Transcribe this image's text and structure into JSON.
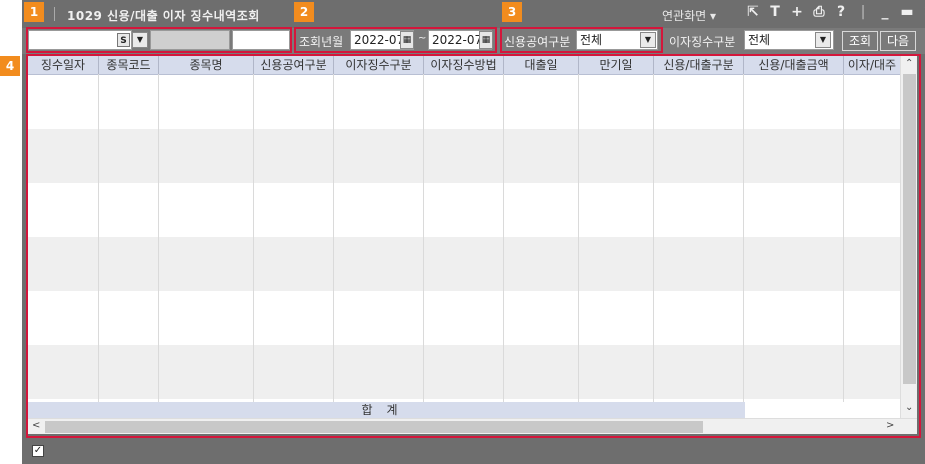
{
  "window": {
    "title": "1029 신용/대출 이자 징수내역조회",
    "related_menu": "연관화면",
    "icons": [
      "pin-icon",
      "text-icon",
      "plus-icon",
      "print-icon",
      "help-icon",
      "minimize-icon",
      "maximize-icon",
      "close-icon"
    ]
  },
  "badges": [
    "1",
    "2",
    "3",
    "4"
  ],
  "search": {
    "account_value": "",
    "s_button": "S",
    "account_name": "",
    "password": ""
  },
  "period": {
    "label": "조회년월",
    "from": "2022-07",
    "separator": "~",
    "to": "2022-07"
  },
  "credit_type": {
    "label": "신용공여구분",
    "selected": "전체"
  },
  "interest_type": {
    "label": "이자징수구분",
    "selected": "전체"
  },
  "buttons": {
    "query": "조회",
    "next": "다음"
  },
  "grid": {
    "columns": [
      "징수일자",
      "종목코드",
      "종목명",
      "신용공여구분",
      "이자징수구분",
      "이자징수방법",
      "대출일",
      "만기일",
      "신용/대출구분",
      "신용/대출금액",
      "이자/대주"
    ],
    "rows": [],
    "total_label": "합계"
  },
  "footer": {
    "checked": true
  },
  "colors": {
    "frame": "#6e6e6e",
    "badge": "#f28c1e",
    "highlight_border": "#d4163b",
    "header_bg": "#d6dcec"
  }
}
